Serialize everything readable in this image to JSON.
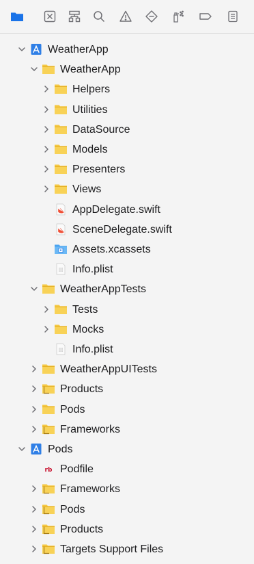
{
  "toolbar": {
    "items": [
      {
        "name": "folder-icon",
        "selected": true
      },
      {
        "name": "x-square-icon"
      },
      {
        "name": "hierarchy-icon"
      },
      {
        "name": "search-icon"
      },
      {
        "name": "warning-icon"
      },
      {
        "name": "diamond-minus-icon"
      },
      {
        "name": "spray-icon"
      },
      {
        "name": "tag-icon"
      },
      {
        "name": "list-icon"
      }
    ],
    "accent": "#1a73e8"
  },
  "tree": [
    {
      "label": "WeatherApp",
      "type": "project",
      "depth": 0,
      "expanded": true
    },
    {
      "label": "WeatherApp",
      "type": "folder",
      "depth": 1,
      "expanded": true
    },
    {
      "label": "Helpers",
      "type": "folder",
      "depth": 2,
      "expanded": false
    },
    {
      "label": "Utilities",
      "type": "folder",
      "depth": 2,
      "expanded": false
    },
    {
      "label": "DataSource",
      "type": "folder",
      "depth": 2,
      "expanded": false
    },
    {
      "label": "Models",
      "type": "folder",
      "depth": 2,
      "expanded": false
    },
    {
      "label": "Presenters",
      "type": "folder",
      "depth": 2,
      "expanded": false
    },
    {
      "label": "Views",
      "type": "folder",
      "depth": 2,
      "expanded": false
    },
    {
      "label": "AppDelegate.swift",
      "type": "swift",
      "depth": 2
    },
    {
      "label": "SceneDelegate.swift",
      "type": "swift",
      "depth": 2
    },
    {
      "label": "Assets.xcassets",
      "type": "assets",
      "depth": 2
    },
    {
      "label": "Info.plist",
      "type": "plist",
      "depth": 2
    },
    {
      "label": "WeatherAppTests",
      "type": "folder",
      "depth": 1,
      "expanded": true
    },
    {
      "label": "Tests",
      "type": "folder",
      "depth": 2,
      "expanded": false
    },
    {
      "label": "Mocks",
      "type": "folder",
      "depth": 2,
      "expanded": false
    },
    {
      "label": "Info.plist",
      "type": "plist",
      "depth": 2
    },
    {
      "label": "WeatherAppUITests",
      "type": "folder",
      "depth": 1,
      "expanded": false
    },
    {
      "label": "Products",
      "type": "folder-special",
      "depth": 1,
      "expanded": false
    },
    {
      "label": "Pods",
      "type": "folder",
      "depth": 1,
      "expanded": false
    },
    {
      "label": "Frameworks",
      "type": "folder-special",
      "depth": 1,
      "expanded": false
    },
    {
      "label": "Pods",
      "type": "project",
      "depth": 0,
      "expanded": true
    },
    {
      "label": "Podfile",
      "type": "ruby",
      "depth": 1
    },
    {
      "label": "Frameworks",
      "type": "folder-special",
      "depth": 1,
      "expanded": false
    },
    {
      "label": "Pods",
      "type": "folder-special",
      "depth": 1,
      "expanded": false
    },
    {
      "label": "Products",
      "type": "folder-special",
      "depth": 1,
      "expanded": false
    },
    {
      "label": "Targets Support Files",
      "type": "folder-special",
      "depth": 1,
      "expanded": false
    }
  ],
  "colors": {
    "folder": "#f5c842",
    "folder_dark": "#e0a81e",
    "project": "#2f7fe6",
    "swift": "#f05138",
    "chevron": "#6e6e73"
  }
}
